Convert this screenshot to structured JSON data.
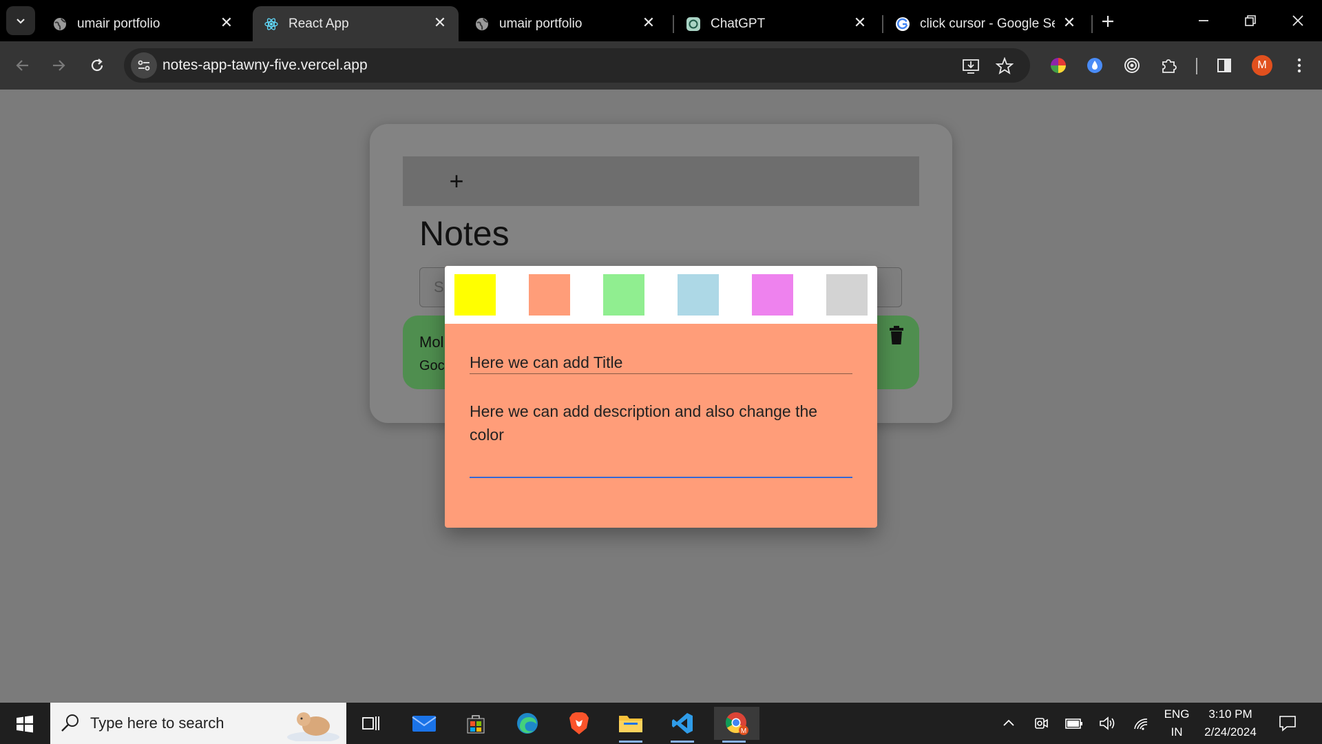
{
  "browser": {
    "tabs": [
      {
        "title": "umair portfolio",
        "favicon": "globe-icon",
        "active": false
      },
      {
        "title": "React App",
        "favicon": "react-icon",
        "active": true
      },
      {
        "title": "umair portfolio",
        "favicon": "globe-icon",
        "active": false
      },
      {
        "title": "ChatGPT",
        "favicon": "chatgpt-icon",
        "active": false
      },
      {
        "title": "click cursor - Google Sear",
        "favicon": "google-icon",
        "active": false
      }
    ],
    "url": "notes-app-tawny-five.vercel.app",
    "profile_initial": "M"
  },
  "app": {
    "add_label": "+",
    "heading": "Notes",
    "search_placeholder": "S",
    "notes": [
      {
        "title": "Mol",
        "description": "Goc",
        "color": "#4f8e4f"
      }
    ]
  },
  "modal": {
    "selected_color": "#ff9d79",
    "color_options": [
      "#ffff00",
      "#ff9d79",
      "#90ee90",
      "#add8e6",
      "#ee82ee",
      "#d3d3d3"
    ],
    "title_value": "Here we can add Title",
    "description_value": "Here we can add description and also change the color"
  },
  "taskbar": {
    "search_placeholder": "Type here to search",
    "apps": [
      "task-view-icon",
      "mail-icon",
      "store-icon",
      "edge-icon",
      "brave-icon",
      "file-explorer-icon",
      "vscode-icon",
      "chrome-icon"
    ],
    "language": "ENG",
    "region": "IN",
    "time": "3:10 PM",
    "date": "2/24/2024"
  }
}
